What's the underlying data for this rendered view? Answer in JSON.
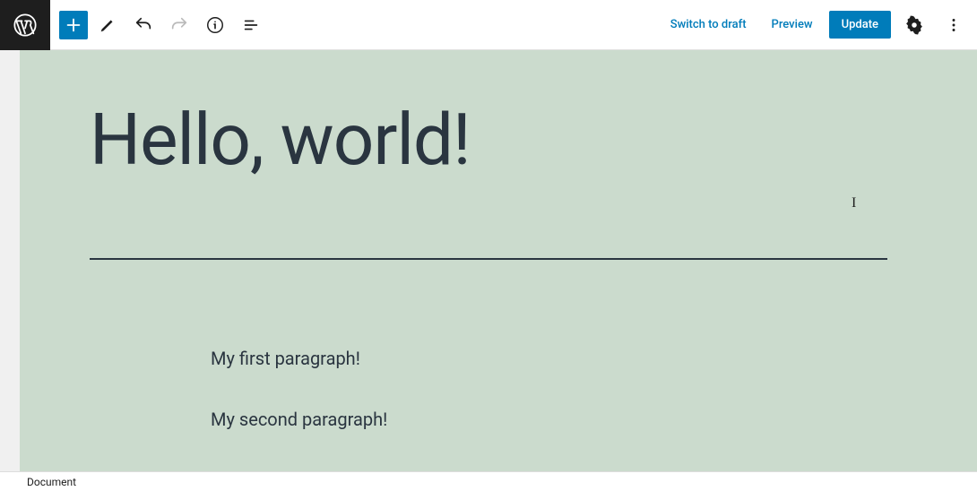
{
  "toolbar": {
    "switch_to_draft": "Switch to draft",
    "preview": "Preview",
    "update": "Update"
  },
  "post": {
    "title": "Hello, world!",
    "paragraphs": [
      "My first paragraph!",
      "My second paragraph!"
    ]
  },
  "status": {
    "breadcrumb": "Document"
  },
  "icons": {
    "wp_logo": "wordpress-logo",
    "add": "plus",
    "edit_mode": "pencil",
    "undo": "undo",
    "redo": "redo",
    "info": "info",
    "outline": "list-outline",
    "settings": "gear",
    "more": "more-vertical"
  }
}
